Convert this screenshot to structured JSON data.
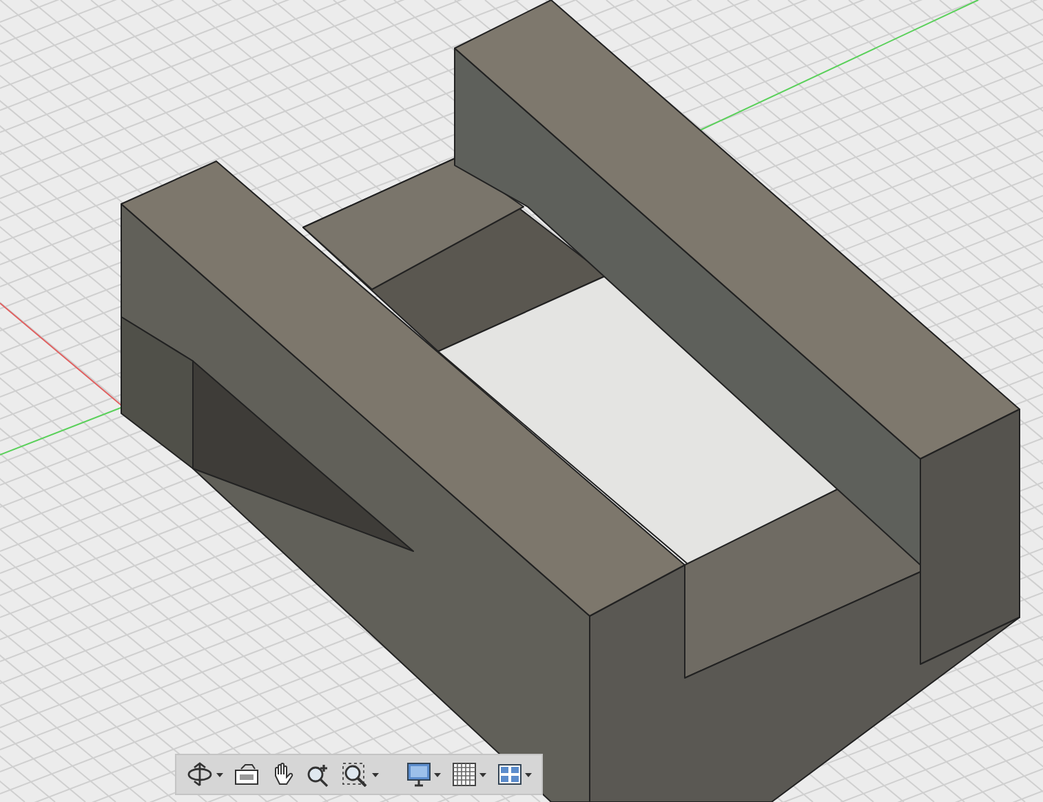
{
  "viewport": {
    "toolbar": {
      "groups": [
        [
          {
            "kind": "orbit",
            "dropdown": true
          },
          {
            "kind": "look-at",
            "dropdown": false
          },
          {
            "kind": "pan",
            "dropdown": false
          },
          {
            "kind": "zoom",
            "dropdown": false
          },
          {
            "kind": "fit",
            "dropdown": true
          }
        ],
        [
          {
            "kind": "display",
            "dropdown": true
          },
          {
            "kind": "grid",
            "dropdown": true
          },
          {
            "kind": "viewports",
            "dropdown": true
          }
        ]
      ]
    }
  }
}
